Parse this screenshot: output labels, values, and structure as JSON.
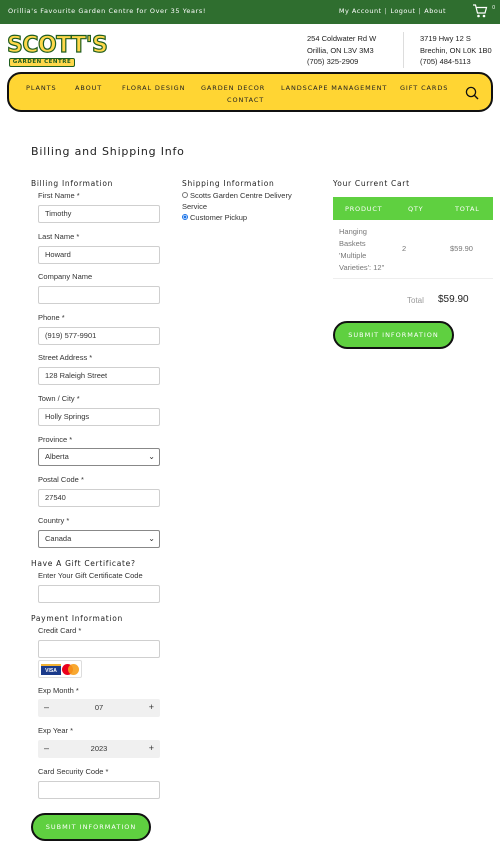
{
  "topbar": {
    "tagline": "Orillia's Favourite Garden Centre for Over 35 Years!",
    "links": [
      "My Account",
      "Logout",
      "About"
    ],
    "cart_count": "0"
  },
  "logo": {
    "main": "SCOTT'S",
    "sub": "GARDEN CENTRE"
  },
  "locations": [
    {
      "street": "254 Coldwater Rd W",
      "city": "Orillia, ON L3V 3M3",
      "phone": "(705) 325-2909"
    },
    {
      "street": "3719 Hwy 12 S",
      "city": "Brechin, ON L0K 1B0",
      "phone": "(705) 484-5113"
    }
  ],
  "nav": [
    "PLANTS",
    "ABOUT",
    "FLORAL DESIGN",
    "GARDEN DECOR",
    "LANDSCAPE MANAGEMENT",
    "GIFT CARDS",
    "CONTACT"
  ],
  "page_title": "Billing and Shipping Info",
  "billing": {
    "heading": "Billing Information",
    "first_name_label": "First Name *",
    "first_name": "Timothy",
    "last_name_label": "Last Name *",
    "last_name": "Howard",
    "company_label": "Company Name",
    "company": "",
    "phone_label": "Phone *",
    "phone": "(919) 577-9901",
    "street_label": "Street Address *",
    "street": "128 Raleigh Street",
    "city_label": "Town / City *",
    "city": "Holly Springs",
    "province_label": "Province *",
    "province": "Alberta",
    "postal_label": "Postal Code *",
    "postal": "27540",
    "country_label": "Country *",
    "country": "Canada"
  },
  "gift": {
    "heading": "Have A Gift Certificate?",
    "label": "Enter Your Gift Certificate Code",
    "value": ""
  },
  "payment": {
    "heading": "Payment Information",
    "card_label": "Credit Card *",
    "card": "",
    "card_logos": [
      "VISA",
      "mastercard"
    ],
    "exp_month_label": "Exp Month *",
    "exp_month": "07",
    "exp_year_label": "Exp Year *",
    "exp_year": "2023",
    "cvv_label": "Card Security Code *",
    "cvv": ""
  },
  "shipping": {
    "heading": "Shipping Information",
    "options": [
      {
        "label": "Scotts Garden Centre Delivery Service",
        "selected": false
      },
      {
        "label": "Customer Pickup",
        "selected": true
      }
    ]
  },
  "cart": {
    "heading": "Your Current Cart",
    "columns": [
      "PRODUCT",
      "QTY",
      "TOTAL"
    ],
    "items": [
      {
        "product": "Hanging Baskets 'Multiple Varieties': 12\"",
        "qty": "2",
        "total": "$59.90"
      }
    ],
    "total_label": "Total",
    "total": "$59.90"
  },
  "submit_label": "SUBMIT INFORMATION",
  "colors": {
    "green": "#2f6e2f",
    "accent_green": "#5fd040",
    "yellow": "#ffd533"
  }
}
